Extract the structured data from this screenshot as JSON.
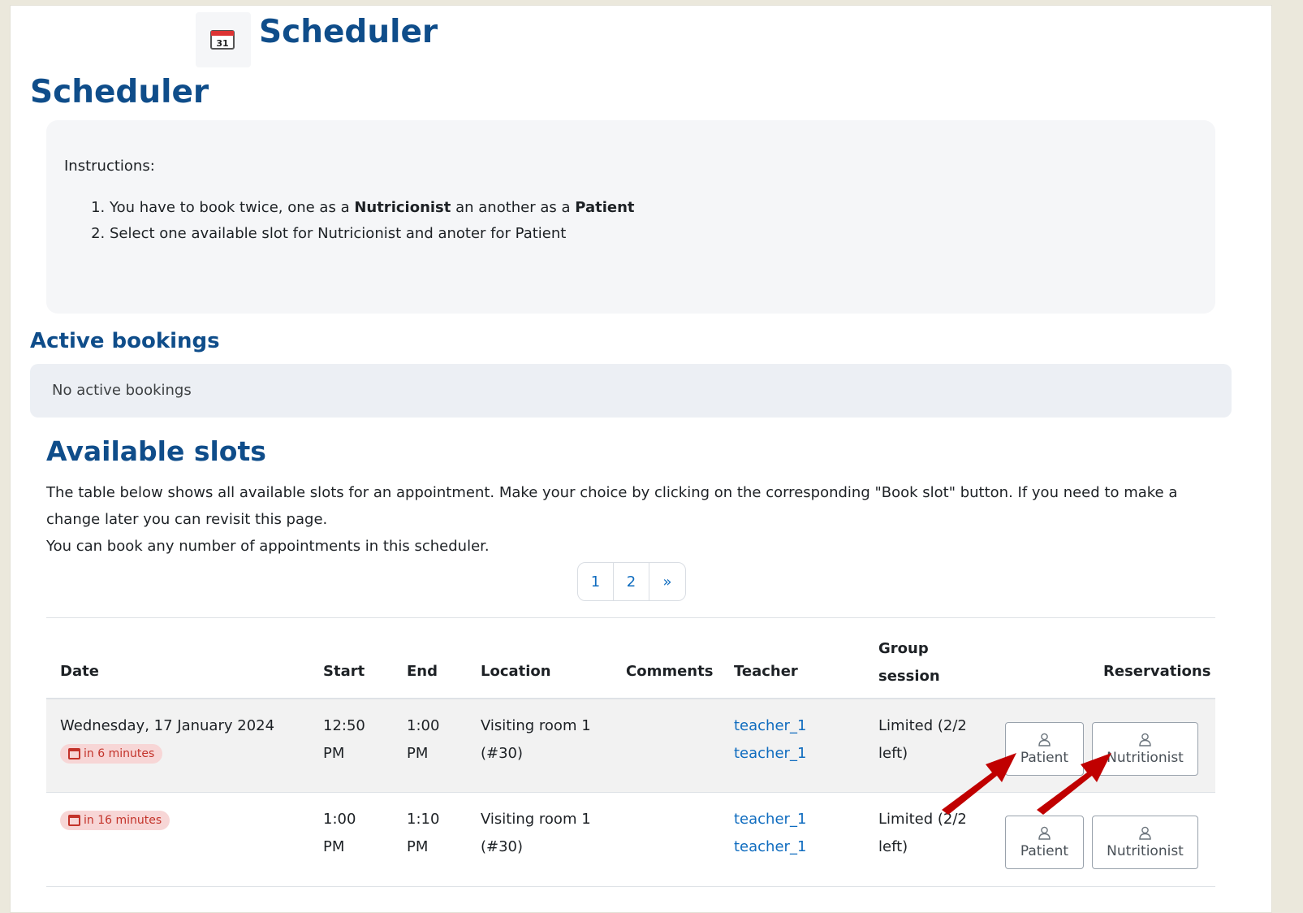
{
  "header": {
    "title": "Scheduler",
    "icon": "calendar-icon",
    "icon_day": "31"
  },
  "page": {
    "title": "Scheduler"
  },
  "instructions": {
    "label": "Instructions:",
    "item1_prefix": "You have to book twice, one as a ",
    "item1_bold1": "Nutricionist",
    "item1_middle": " an another as a ",
    "item1_bold2": "Patient",
    "item2": "Select one available slot for Nutricionist and anoter for Patient"
  },
  "active_bookings": {
    "title": "Active bookings",
    "empty_text": "No active bookings"
  },
  "available_slots": {
    "title": "Available slots",
    "desc_line1": "The table below shows all available slots for an appointment. Make your choice by clicking on the corresponding \"Book slot\" button. If you need to make a change later you can revisit this page.",
    "desc_line2": "You can book any number of appointments in this scheduler."
  },
  "pagination": {
    "pages": [
      "1",
      "2"
    ],
    "next": "»"
  },
  "table": {
    "headers": {
      "date": "Date",
      "start": "Start",
      "end": "End",
      "location": "Location",
      "comments": "Comments",
      "teacher": "Teacher",
      "group_line1": "Group",
      "group_line2": "session",
      "reservations": "Reservations"
    },
    "rows": [
      {
        "date": "Wednesday, 17 January 2024",
        "badge": "in 6 minutes",
        "start_time": "12:50",
        "start_ampm": "PM",
        "end_time": "1:00",
        "end_ampm": "PM",
        "location_line1": "Visiting room 1",
        "location_line2": "(#30)",
        "teacher1": "teacher_1",
        "teacher2": "teacher_1",
        "group_line1": "Limited (2/2",
        "group_line2": "left)",
        "btn_patient": "Patient",
        "btn_nutritionist": "Nutritionist"
      },
      {
        "date": "",
        "badge": "in 16 minutes",
        "start_time": "1:00",
        "start_ampm": "PM",
        "end_time": "1:10",
        "end_ampm": "PM",
        "location_line1": "Visiting room 1",
        "location_line2": "(#30)",
        "teacher1": "teacher_1",
        "teacher2": "teacher_1",
        "group_line1": "Limited (2/2",
        "group_line2": "left)",
        "btn_patient": "Patient",
        "btn_nutritionist": "Nutritionist"
      }
    ]
  },
  "colors": {
    "heading": "#0f4d8a",
    "link": "#0f6cbf",
    "badge_bg": "#f7d6d6",
    "badge_text": "#c3332a",
    "arrow": "#c00000"
  }
}
